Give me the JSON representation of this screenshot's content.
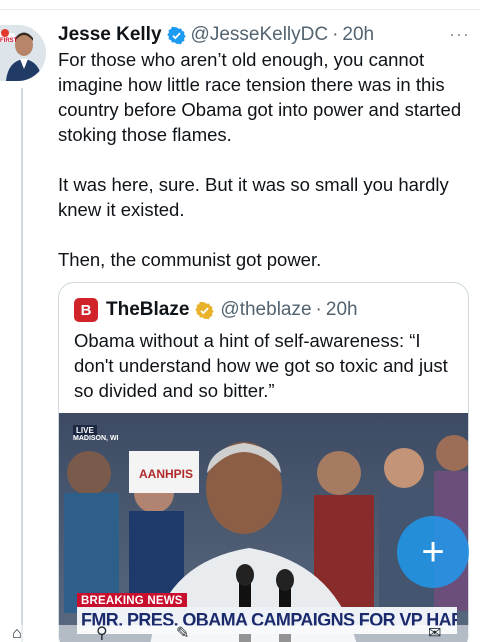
{
  "tweet": {
    "author_name": "Jesse Kelly",
    "handle": "@JesseKellyDC",
    "separator": "·",
    "time": "20h",
    "more": "···",
    "text": "For those who aren’t old enough, you cannot imagine how little race tension there was in this country before Obama got into power and started stoking those flames.\n\nIt was here, sure. But it was so small you hardly knew it existed.\n\nThen, the communist got power.",
    "avatar_badge": "FIRST"
  },
  "quote": {
    "logo_letter": "B",
    "author_name": "TheBlaze",
    "handle": "@theblaze",
    "separator": "·",
    "time": "20h",
    "text": "Obama without a hint of self-awareness: “I don't understand how we got so toxic and just so divided and so bitter.”",
    "video": {
      "live_label": "LIVE",
      "location": "MADISON, WI",
      "sign_text": "AANHPIS",
      "breaking_label": "BREAKING NEWS",
      "chyron": "FMR. PRES. OBAMA CAMPAIGNS FOR VP HARRIS"
    }
  },
  "compose_button": {
    "label": "+"
  },
  "bottom_nav": {
    "home": "⌂",
    "search": "⚲",
    "compose": "✎",
    "mail": "✉"
  },
  "colors": {
    "verified_blue": "#1d9bf0",
    "gold_badge": "#e8b32a",
    "blaze_red": "#d0232a",
    "fab_blue": "#1d9bf0"
  }
}
